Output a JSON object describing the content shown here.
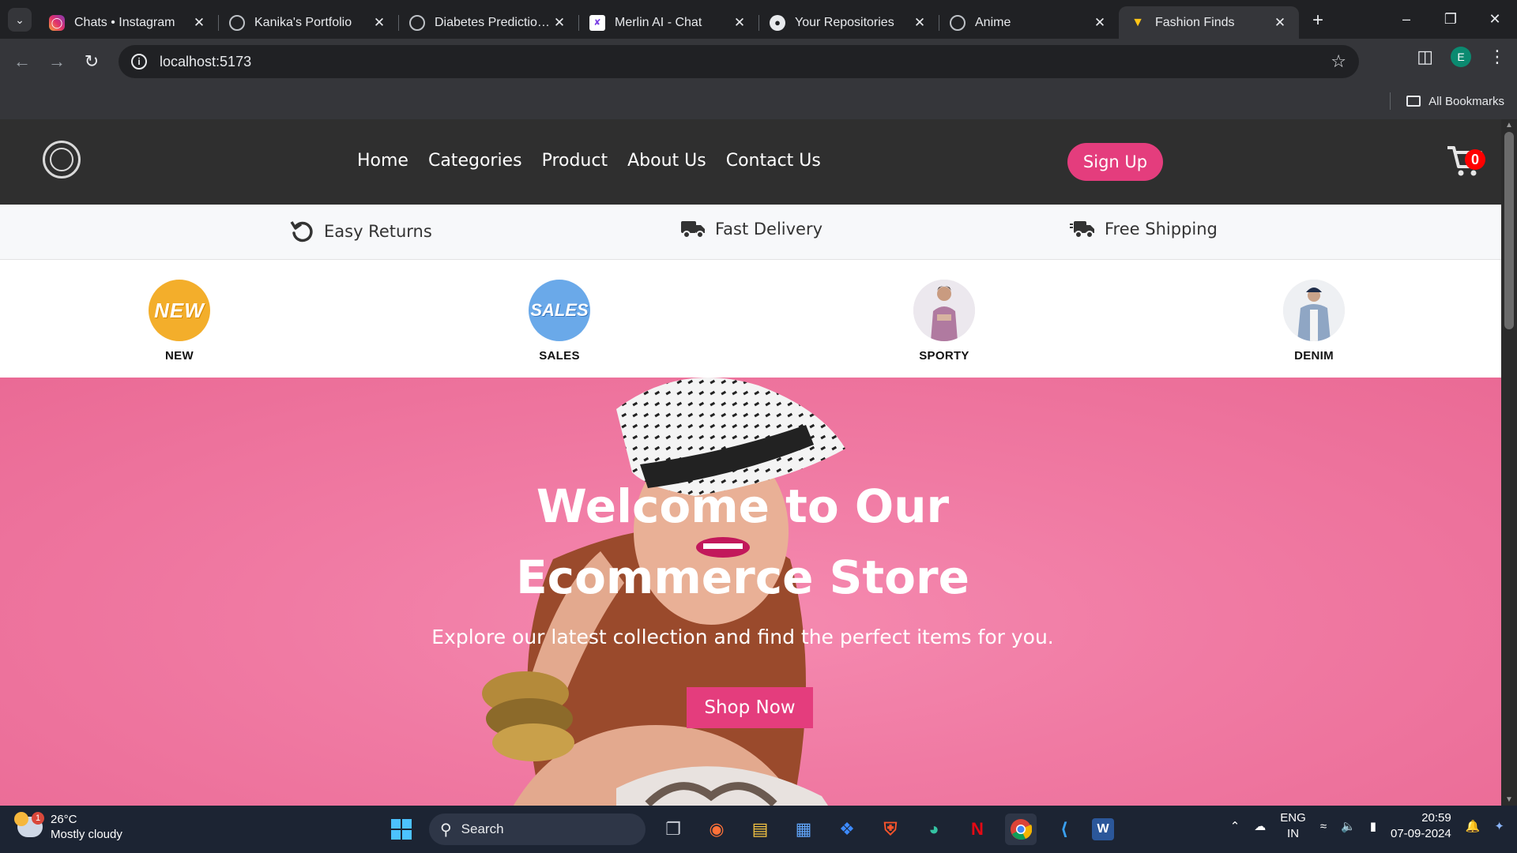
{
  "browser": {
    "tabs": [
      {
        "title": "Chats • Instagram",
        "active": false
      },
      {
        "title": "Kanika's Portfolio",
        "active": false
      },
      {
        "title": "Diabetes Prediction App",
        "active": false
      },
      {
        "title": "Merlin AI - Chat",
        "active": false
      },
      {
        "title": "Your Repositories",
        "active": false
      },
      {
        "title": "Anime",
        "active": false
      },
      {
        "title": "Fashion Finds",
        "active": true
      }
    ],
    "url": "localhost:5173",
    "profile_initial": "E",
    "bookmarks_label": "All Bookmarks"
  },
  "site": {
    "nav": [
      "Home",
      "Categories",
      "Product",
      "About Us",
      "Contact Us"
    ],
    "signup_label": "Sign Up",
    "cart_count": "0",
    "features": [
      "Easy Returns",
      "Fast Delivery",
      "Free Shipping"
    ],
    "categories": [
      {
        "label": "NEW",
        "badge": "NEW"
      },
      {
        "label": "SALES",
        "badge": "SALES"
      },
      {
        "label": "SPORTY"
      },
      {
        "label": "DENIM"
      }
    ],
    "hero": {
      "title_line1": "Welcome to Our",
      "title_line2": "Ecommerce Store",
      "subtitle": "Explore our latest collection and find the perfect items for you.",
      "cta": "Shop Now"
    }
  },
  "taskbar": {
    "weather_temp": "26°C",
    "weather_desc": "Mostly cloudy",
    "weather_badge": "1",
    "search_label": "Search",
    "lang_line1": "ENG",
    "lang_line2": "IN",
    "time": "20:59",
    "date": "07-09-2024"
  },
  "colors": {
    "accent": "#e43d7d",
    "hero_bg": "#f07aa3",
    "header_bg": "#2f2f2f"
  }
}
